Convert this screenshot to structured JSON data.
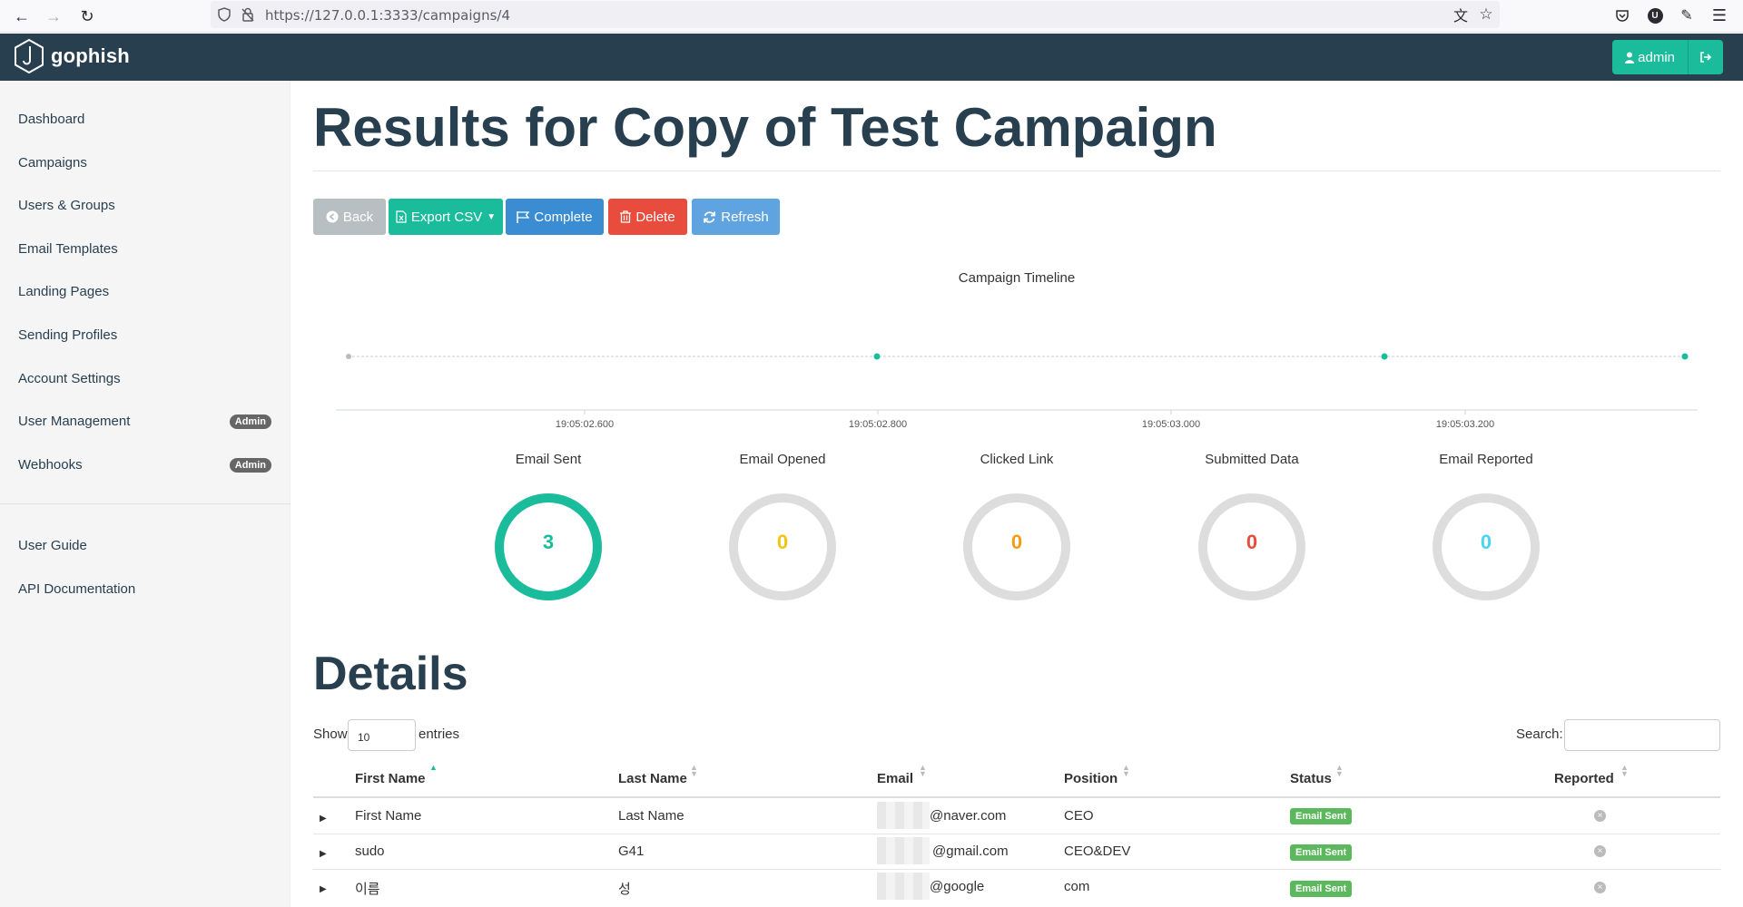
{
  "browser": {
    "url": "https://127.0.0.1:3333/campaigns/4"
  },
  "navbar": {
    "brand": "gophish",
    "user_button": "admin"
  },
  "sidebar": {
    "items": [
      {
        "label": "Dashboard"
      },
      {
        "label": "Campaigns"
      },
      {
        "label": "Users & Groups"
      },
      {
        "label": "Email Templates"
      },
      {
        "label": "Landing Pages"
      },
      {
        "label": "Sending Profiles"
      },
      {
        "label": "Account Settings"
      },
      {
        "label": "User Management",
        "badge": "Admin"
      },
      {
        "label": "Webhooks",
        "badge": "Admin"
      }
    ],
    "footer_items": [
      {
        "label": "User Guide"
      },
      {
        "label": "API Documentation"
      }
    ]
  },
  "page": {
    "title": "Results for Copy of Test Campaign"
  },
  "toolbar": {
    "back": "Back",
    "export": "Export CSV",
    "complete": "Complete",
    "delete": "Delete",
    "refresh": "Refresh"
  },
  "timeline": {
    "title": "Campaign Timeline",
    "ticks": [
      "19:05:02.600",
      "19:05:02.800",
      "19:05:03.000",
      "19:05:03.200"
    ]
  },
  "stats": [
    {
      "label": "Email Sent",
      "value": "3",
      "color": "#1abc9c",
      "fraction": 1
    },
    {
      "label": "Email Opened",
      "value": "0",
      "color": "#f1c40f",
      "fraction": 0
    },
    {
      "label": "Clicked Link",
      "value": "0",
      "color": "#f39c12",
      "fraction": 0
    },
    {
      "label": "Submitted Data",
      "value": "0",
      "color": "#e74c3c",
      "fraction": 0
    },
    {
      "label": "Email Reported",
      "value": "0",
      "color": "#45d6ef",
      "fraction": 0
    }
  ],
  "details": {
    "title": "Details",
    "show_label": "Show",
    "page_size": "10",
    "entries_label": "entries",
    "search_label": "Search:",
    "columns": [
      "First Name",
      "Last Name",
      "Email",
      "Position",
      "Status",
      "Reported"
    ],
    "rows": [
      {
        "first": "First Name",
        "last": "Last Name",
        "email": "@naver.com",
        "position": "CEO",
        "status": "Email Sent"
      },
      {
        "first": "sudo",
        "last": "G41",
        "email": "@gmail.com",
        "position": "CEO&DEV",
        "status": "Email Sent"
      },
      {
        "first": "이름",
        "last": "성",
        "email": "@google",
        "position": "com",
        "status": "Email Sent"
      }
    ]
  }
}
